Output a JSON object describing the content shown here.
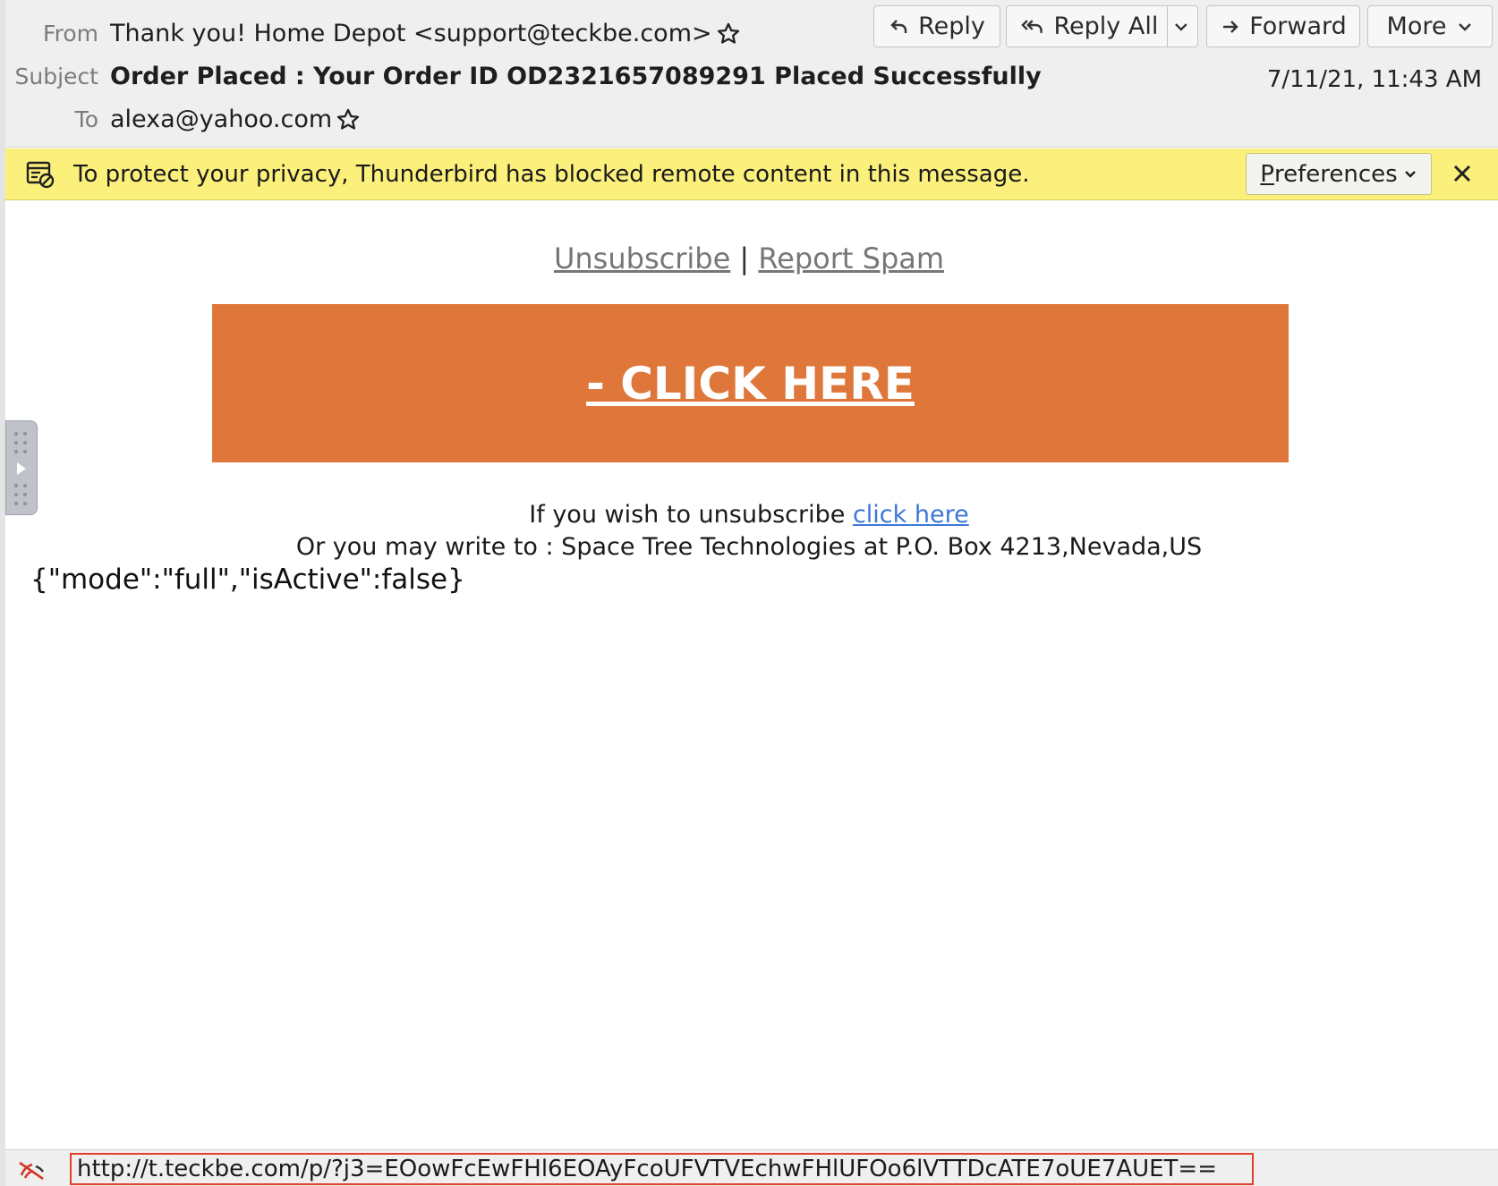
{
  "header": {
    "from_label": "From",
    "from_value": "Thank you! Home Depot <support@teckbe.com>",
    "subject_label": "Subject",
    "subject_value": "Order Placed : Your Order ID OD2321657089291 Placed Successfully",
    "to_label": "To",
    "to_value": "alexa@yahoo.com",
    "date": "7/11/21, 11:43 AM",
    "buttons": {
      "reply": "Reply",
      "reply_all": "Reply All",
      "forward": "Forward",
      "more": "More"
    }
  },
  "notification": {
    "text": "To protect your privacy, Thunderbird has blocked remote content in this message.",
    "preferences_first_letter": "P",
    "preferences_rest": "references"
  },
  "message": {
    "unsubscribe_link": "Unsubscribe",
    "separator": "|",
    "report_spam_link": "Report Spam",
    "cta_text": "- CLICK HERE",
    "unsub_prefix": "If you wish to unsubscribe",
    "unsub_link": "click here",
    "address": "Or you may write to : Space Tree Technologies at P.O. Box 4213,Nevada,US",
    "json_text": "{\"mode\":\"full\",\"isActive\":false}"
  },
  "statusbar": {
    "url": "http://t.teckbe.com/p/?j3=EOowFcEwFHl6EOAyFcoUFVTVEchwFHlUFOo6lVTTDcATE7oUE7AUET=="
  },
  "colors": {
    "cta_background": "#df773a",
    "notification_background": "#fbf07c",
    "link_blue": "#3d78d6",
    "status_highlight": "#e0402c"
  },
  "icons": [
    "star-icon",
    "reply-icon",
    "reply-all-icon",
    "chevron-down-icon",
    "forward-icon",
    "blocked-content-icon",
    "close-icon",
    "play-icon",
    "connection-icon"
  ]
}
